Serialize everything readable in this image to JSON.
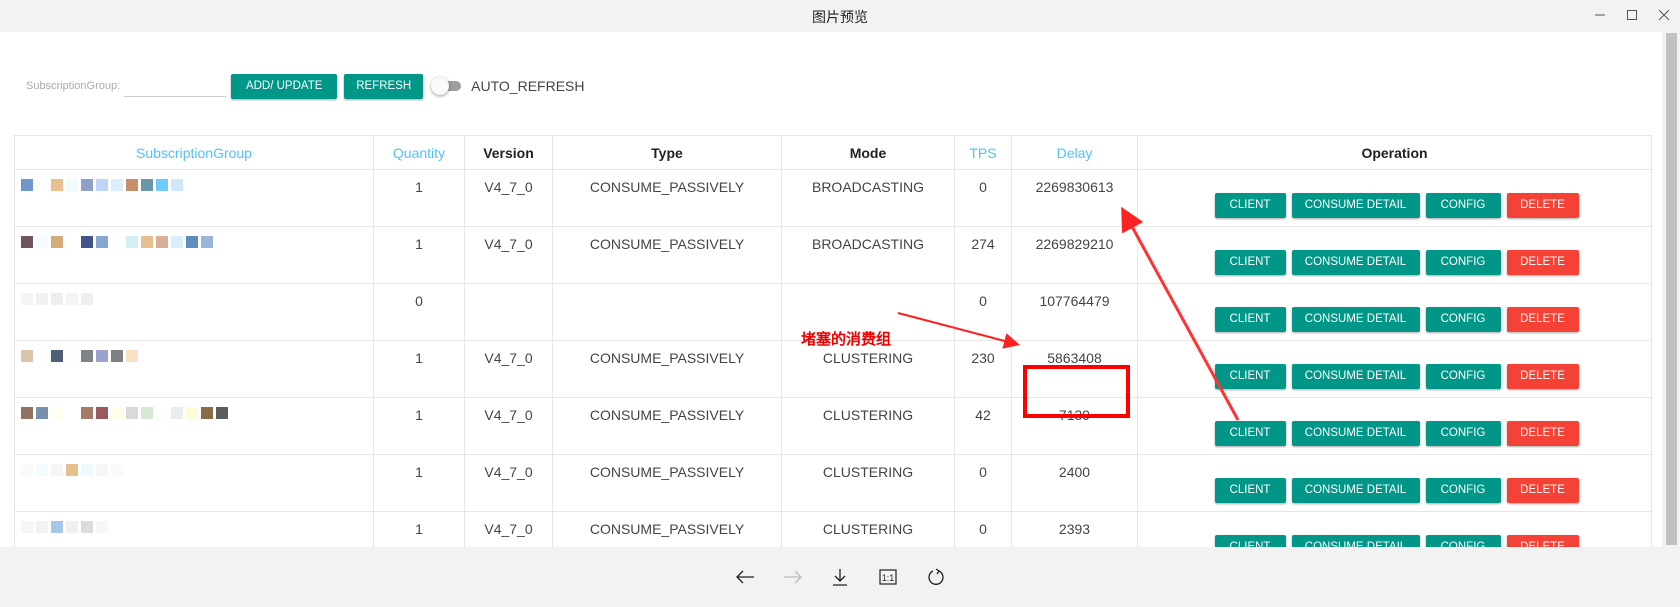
{
  "window": {
    "title": "图片预览",
    "controls": [
      "minimize",
      "maximize",
      "close"
    ]
  },
  "filter": {
    "label": "SubscriptionGroup:",
    "input_value": "",
    "add_update_label": "ADD/ UPDATE",
    "refresh_label": "REFRESH",
    "auto_refresh_label": "AUTO_REFRESH",
    "auto_refresh_on": false
  },
  "table": {
    "headers": [
      "SubscriptionGroup",
      "Quantity",
      "Version",
      "Type",
      "Mode",
      "TPS",
      "Delay",
      "Operation"
    ],
    "rows": [
      {
        "group": "",
        "quantity": "1",
        "version": "V4_7_0",
        "type": "CONSUME_PASSIVELY",
        "mode": "BROADCASTING",
        "tps": "0",
        "delay": "2269830613"
      },
      {
        "group": "",
        "quantity": "1",
        "version": "V4_7_0",
        "type": "CONSUME_PASSIVELY",
        "mode": "BROADCASTING",
        "tps": "274",
        "delay": "2269829210"
      },
      {
        "group": "",
        "quantity": "0",
        "version": "",
        "type": "",
        "mode": "",
        "tps": "0",
        "delay": "107764479"
      },
      {
        "group": "",
        "quantity": "1",
        "version": "V4_7_0",
        "type": "CONSUME_PASSIVELY",
        "mode": "CLUSTERING",
        "tps": "230",
        "delay": "5863408"
      },
      {
        "group": "",
        "quantity": "1",
        "version": "V4_7_0",
        "type": "CONSUME_PASSIVELY",
        "mode": "CLUSTERING",
        "tps": "42",
        "delay": "7139"
      },
      {
        "group": "",
        "quantity": "1",
        "version": "V4_7_0",
        "type": "CONSUME_PASSIVELY",
        "mode": "CLUSTERING",
        "tps": "0",
        "delay": "2400"
      },
      {
        "group": "",
        "quantity": "1",
        "version": "V4_7_0",
        "type": "CONSUME_PASSIVELY",
        "mode": "CLUSTERING",
        "tps": "0",
        "delay": "2393"
      }
    ],
    "operations": {
      "client": "CLIENT",
      "consume_detail": "CONSUME DETAIL",
      "config": "CONFIG",
      "delete": "DELETE"
    }
  },
  "annotation": {
    "text": "堵塞的消费组",
    "color": "#ff0000"
  },
  "colors": {
    "primary": "#009688",
    "danger": "#f44336",
    "sortable_header": "#4fc3f7"
  },
  "viewer_toolbar": {
    "buttons": [
      "previous",
      "next",
      "download",
      "actual-size",
      "rotate"
    ],
    "actual_size_label": "1:1"
  }
}
